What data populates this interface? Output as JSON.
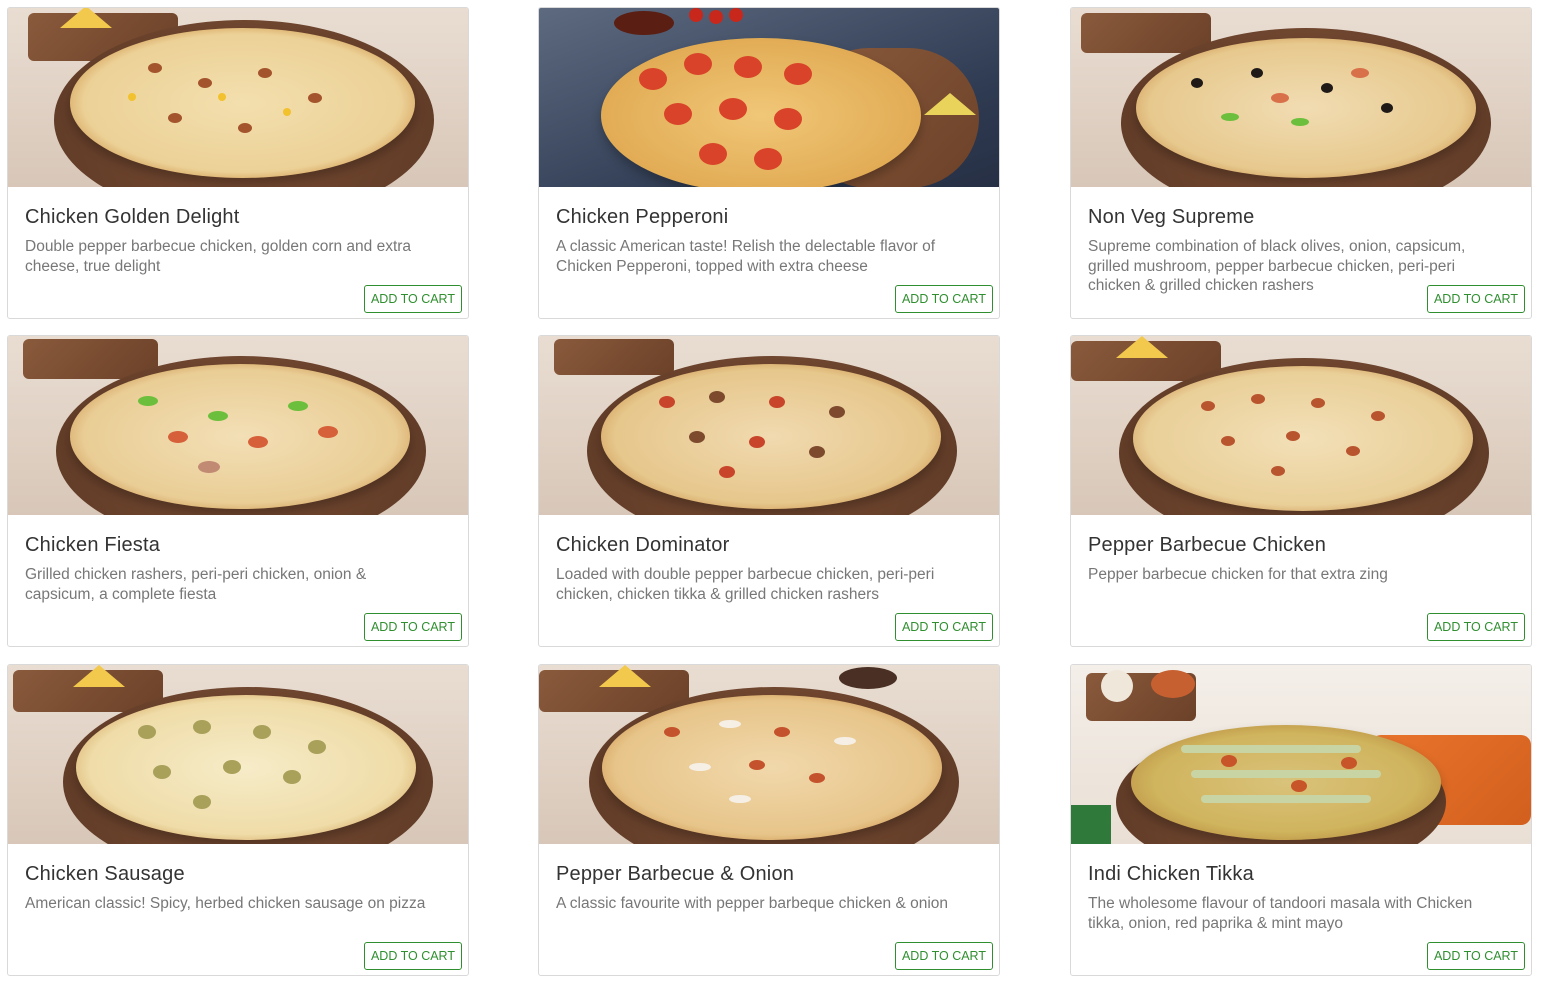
{
  "products": [
    {
      "name": "Chicken Golden Delight",
      "description": "Double pepper barbecue chicken, golden corn and extra cheese, true delight",
      "button": "ADD TO CART"
    },
    {
      "name": "Chicken Pepperoni",
      "description": "A classic American taste! Relish the delectable flavor of Chicken Pepperoni, topped with extra cheese",
      "button": "ADD TO CART"
    },
    {
      "name": "Non Veg Supreme",
      "description": "Supreme combination of black olives, onion, capsicum, grilled mushroom, pepper barbecue chicken, peri-peri chicken & grilled chicken rashers",
      "button": "ADD TO CART"
    },
    {
      "name": "Chicken Fiesta",
      "description": "Grilled chicken rashers, peri-peri chicken, onion & capsicum, a complete fiesta",
      "button": "ADD TO CART"
    },
    {
      "name": "Chicken Dominator",
      "description": "Loaded with double pepper barbecue chicken, peri-peri chicken, chicken tikka & grilled chicken rashers",
      "button": "ADD TO CART"
    },
    {
      "name": "Pepper Barbecue Chicken",
      "description": "Pepper barbecue chicken for that extra zing",
      "button": "ADD TO CART"
    },
    {
      "name": "Chicken Sausage",
      "description": "American classic! Spicy, herbed chicken sausage on pizza",
      "button": "ADD TO CART"
    },
    {
      "name": "Pepper Barbecue & Onion",
      "description": "A classic favourite with pepper barbeque chicken & onion",
      "button": "ADD TO CART"
    },
    {
      "name": "Indi Chicken Tikka",
      "description": "The wholesome flavour of tandoori masala with Chicken tikka, onion, red paprika & mint mayo",
      "button": "ADD TO CART"
    }
  ]
}
